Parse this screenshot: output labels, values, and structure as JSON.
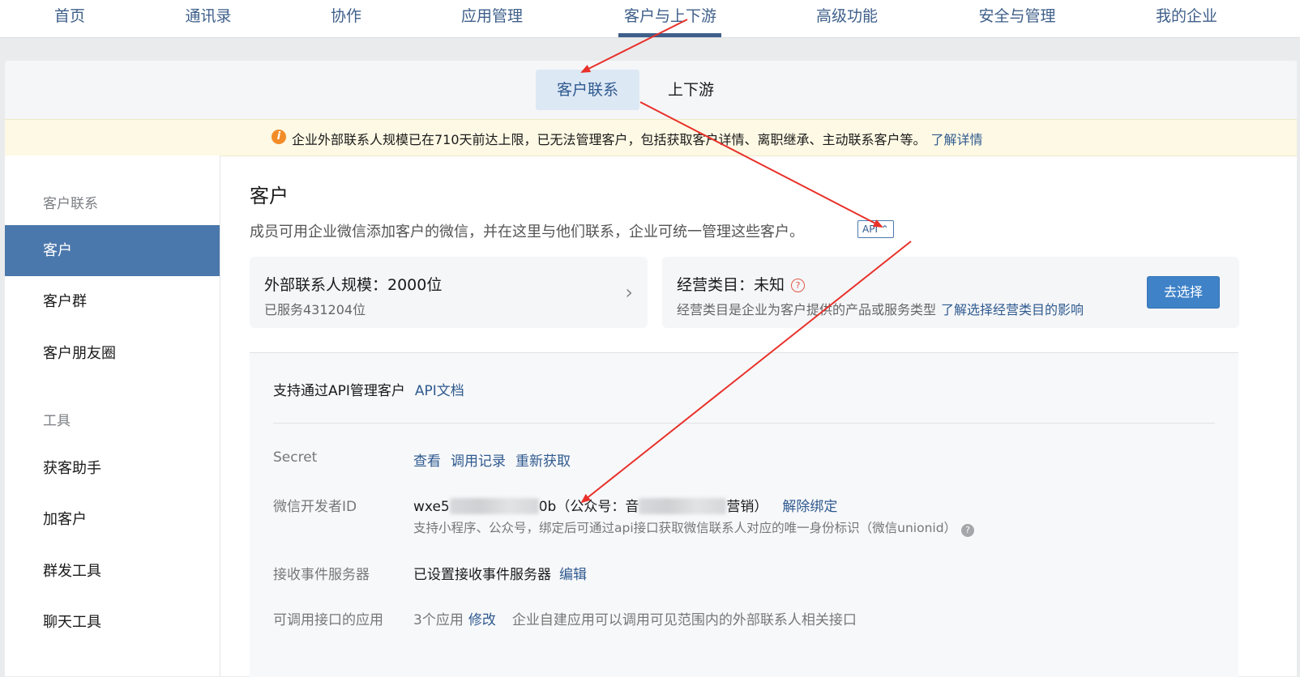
{
  "topnav": {
    "items": [
      "首页",
      "通讯录",
      "协作",
      "应用管理",
      "客户与上下游",
      "高级功能",
      "安全与管理",
      "我的企业"
    ],
    "active_index": 4
  },
  "subtabs": {
    "contact": "客户联系",
    "supply": "上下游"
  },
  "notice": {
    "text": "企业外部联系人规模已在710天前达上限，已无法管理客户，包括获取客户详情、离职继承、主动联系客户等。",
    "link": "了解详情"
  },
  "sidebar": {
    "section1": "客户联系",
    "items1": [
      "客户",
      "客户群",
      "客户朋友圈"
    ],
    "section2": "工具",
    "items2": [
      "获客助手",
      "加客户",
      "群发工具",
      "聊天工具"
    ]
  },
  "main": {
    "title": "客户",
    "desc": "成员可用企业微信添加客户的微信，并在这里与他们联系，企业可统一管理这些客户。",
    "api_tag": "API ⌃",
    "card1": {
      "heading": "外部联系人规模：2000位",
      "sub": "已服务431204位",
      "chevron": "›"
    },
    "card2": {
      "heading": "经营类目：未知",
      "sub": "经营类目是企业为客户提供的产品或服务类型",
      "link": "了解选择经营类目的影响",
      "button": "去选择"
    },
    "api": {
      "heading": "支持通过API管理客户",
      "doc_link": "API文档",
      "secret_label": "Secret",
      "secret_links": [
        "查看",
        "调用记录",
        "重新获取"
      ],
      "devid_label": "微信开发者ID",
      "devid_prefix": "wxe5",
      "devid_mid": "0b（公众号：音",
      "devid_suffix": "营销）",
      "unbind": "解除绑定",
      "devid_note": "支持小程序、公众号，绑定后可通过api接口获取微信联系人对应的唯一身份标识（微信unionid）",
      "server_label": "接收事件服务器",
      "server_value": "已设置接收事件服务器",
      "server_edit": "编辑",
      "apps_label": "可调用接口的应用",
      "apps_value": "3个应用",
      "apps_edit": "修改",
      "apps_note": "企业自建应用可以调用可见范围内的外部联系人相关接口"
    }
  },
  "colors": {
    "accent": "#4b78ac",
    "link": "#2f5a8f",
    "arrow": "#e8312a",
    "notice_bg": "#fdf9e4"
  }
}
